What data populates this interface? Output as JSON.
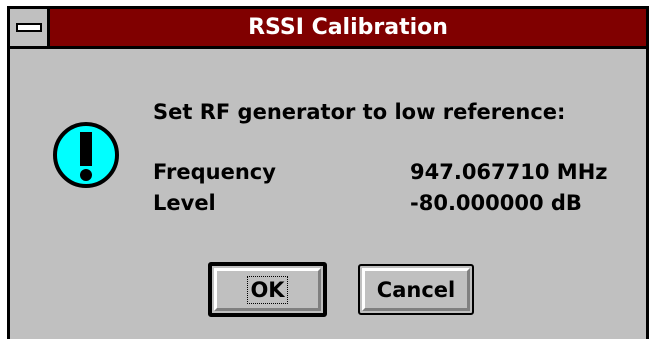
{
  "window": {
    "title": "RSSI Calibration"
  },
  "dialog": {
    "message": "Set RF generator to low reference:",
    "icon": "exclamation-icon",
    "fields": [
      {
        "label": "Frequency",
        "value": "947.067710 MHz"
      },
      {
        "label": "Level",
        "value": "-80.000000 dB"
      }
    ]
  },
  "buttons": {
    "ok_label": "OK",
    "cancel_label": "Cancel"
  },
  "colors": {
    "titlebar": "#800000",
    "face": "#c0c0c0",
    "icon_fill": "#00ffff"
  }
}
